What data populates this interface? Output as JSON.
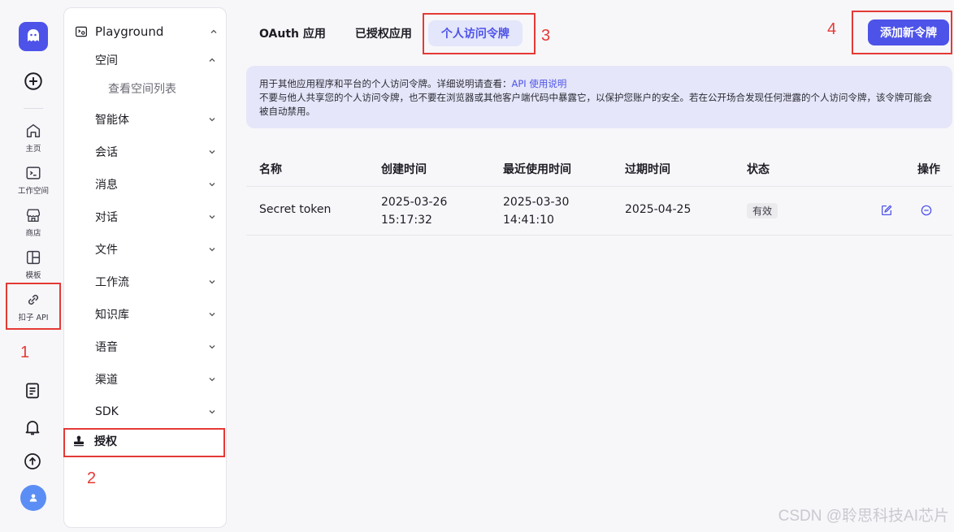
{
  "rail": {
    "items": [
      {
        "label": "主页",
        "icon": "home-icon"
      },
      {
        "label": "工作空间",
        "icon": "terminal-icon"
      },
      {
        "label": "商店",
        "icon": "store-icon"
      },
      {
        "label": "模板",
        "icon": "template-icon"
      },
      {
        "label": "扣子 API",
        "icon": "api-link-icon"
      }
    ]
  },
  "subnav": {
    "header": "Playground",
    "space": "空间",
    "space_sub": "查看空间列表",
    "items": [
      "智能体",
      "会话",
      "消息",
      "对话",
      "文件",
      "工作流",
      "知识库",
      "语音",
      "渠道",
      "SDK"
    ],
    "auth": "授权"
  },
  "tabs": [
    {
      "label": "OAuth 应用",
      "active": false
    },
    {
      "label": "已授权应用",
      "active": false
    },
    {
      "label": "个人访问令牌",
      "active": true
    }
  ],
  "add_button": "添加新令牌",
  "notice": {
    "line1_prefix": "用于其他应用程序和平台的个人访问令牌。详细说明请查看：",
    "line1_link": "API 使用说明",
    "line2": "不要与他人共享您的个人访问令牌，也不要在浏览器或其他客户端代码中暴露它，以保护您账户的安全。若在公开场合发现任何泄露的个人访问令牌，该令牌可能会被自动禁用。"
  },
  "table": {
    "headers": {
      "name": "名称",
      "created": "创建时间",
      "last_used": "最近使用时间",
      "expires": "过期时间",
      "status": "状态",
      "actions": "操作"
    },
    "rows": [
      {
        "name": "Secret token",
        "created_date": "2025-03-26",
        "created_time": "15:17:32",
        "last_used_date": "2025-03-30",
        "last_used_time": "14:41:10",
        "expires": "2025-04-25",
        "status": "有效"
      }
    ]
  },
  "annotations": [
    "1",
    "2",
    "3",
    "4"
  ],
  "watermark": "CSDN @聆思科技AI芯片",
  "colors": {
    "accent": "#4d53e8",
    "annotation": "#e53935"
  }
}
